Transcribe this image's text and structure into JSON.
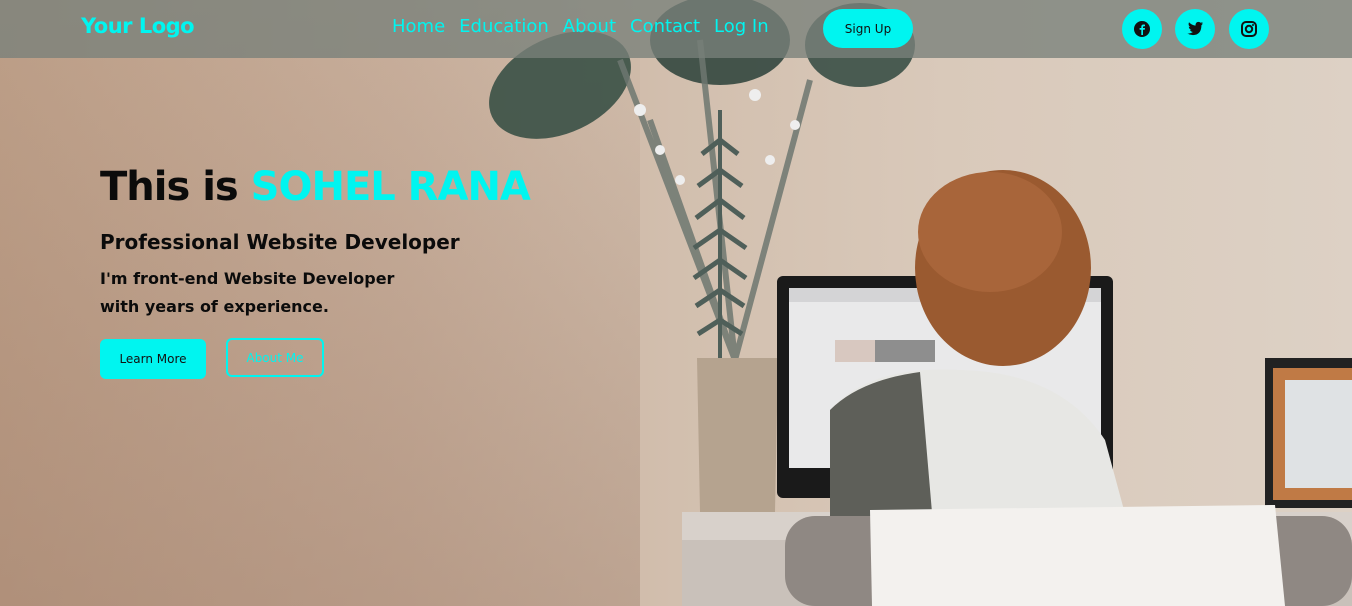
{
  "header": {
    "logo": "Your Logo",
    "nav": [
      "Home",
      "Education",
      "About",
      "Contact",
      "Log In"
    ],
    "signup_label": "Sign Up",
    "social_icons": [
      "facebook-icon",
      "twitter-icon",
      "instagram-icon"
    ]
  },
  "hero": {
    "title_prefix": "This is ",
    "title_name": "SOHEL RANA",
    "subtitle": "Professional Website Developer",
    "desc_line1": "I'm front-end Website Developer",
    "desc_line2": "with years of experience.",
    "learn_more_label": "Learn More",
    "about_me_label": "About Me"
  },
  "colors": {
    "accent": "#00f5f0",
    "header_bg": "#78807a",
    "text": "#0b0b0b"
  }
}
